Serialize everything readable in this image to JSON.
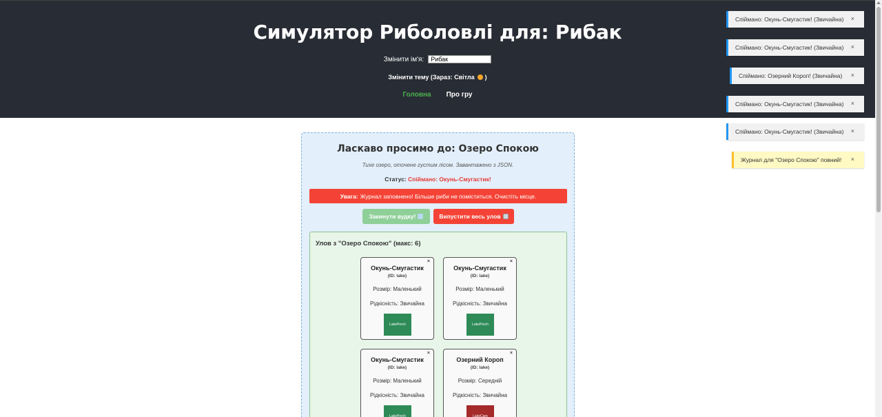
{
  "header": {
    "title": "Симулятор Риболовлі для: Рибак",
    "name_label": "Змінити ім'я:",
    "name_value": "Рибак",
    "theme_button": "Змінити тему (Зараз: Світла",
    "theme_button_end": ")",
    "nav": {
      "home": "Головна",
      "about": "Про гру"
    }
  },
  "location": {
    "title": "Ласкаво просимо до: Озеро Спокою",
    "description": "Тихе озеро, оточене густим лісом. Завантажено з JSON.",
    "status_label": "Статус:",
    "status_value": "Спіймано: Окунь-Смугастик!",
    "warning_label": "Увага:",
    "warning_text": "Журнал заповнено! Більше риби не поміститься. Очистіть місце.",
    "cast_button": "Закинути вудку!",
    "release_button": "Випустити весь улов"
  },
  "catch": {
    "title": "Улов з \"Озеро Спокою\" (макс: 6)",
    "items": [
      {
        "name": "Окунь-Смугастик",
        "id": "(ID: lake)",
        "size": "Розмір: Маленький",
        "rarity": "Рідкісність: Звичайна",
        "image_label": "LakePerch",
        "image_color": "#2e8b57"
      },
      {
        "name": "Окунь-Смугастик",
        "id": "(ID: lake)",
        "size": "Розмір: Маленький",
        "rarity": "Рідкісність: Звичайна",
        "image_label": "LakePerch",
        "image_color": "#2e8b57"
      },
      {
        "name": "Окунь-Смугастик",
        "id": "(ID: lake)",
        "size": "Розмір: Маленький",
        "rarity": "Рідкісність: Звичайна",
        "image_label": "LakePerch",
        "image_color": "#2e8b57"
      },
      {
        "name": "Озерний Короп",
        "id": "(ID: lake)",
        "size": "Розмір: Середній",
        "rarity": "Рідкісність: Звичайна",
        "image_label": "LakeCarp",
        "image_color": "#a52a2a"
      }
    ],
    "close_glyph": "×"
  },
  "toasts": [
    {
      "text": "Спіймано: Окунь-Смугастик! (Звичайна)",
      "close": "×"
    },
    {
      "text": "Спіймано: Окунь-Смугастик! (Звичайна)",
      "close": "×"
    },
    {
      "text": "Спіймано: Озерний Короп! (Звичайна)",
      "close": "×"
    },
    {
      "text": "Спіймано: Окунь-Смугастик! (Звичайна)",
      "close": "×"
    },
    {
      "text": "Спіймано: Окунь-Смугастик! (Звичайна)",
      "close": "×"
    },
    {
      "text": "Журнал для \"Озеро Спокою\" повний!",
      "close": "×"
    }
  ],
  "colors": {
    "header_bg": "#282c34",
    "accent_green": "#4caf50",
    "danger_red": "#f44336",
    "info_blue": "#2196f3",
    "warn_yellow": "#fbc02d"
  }
}
